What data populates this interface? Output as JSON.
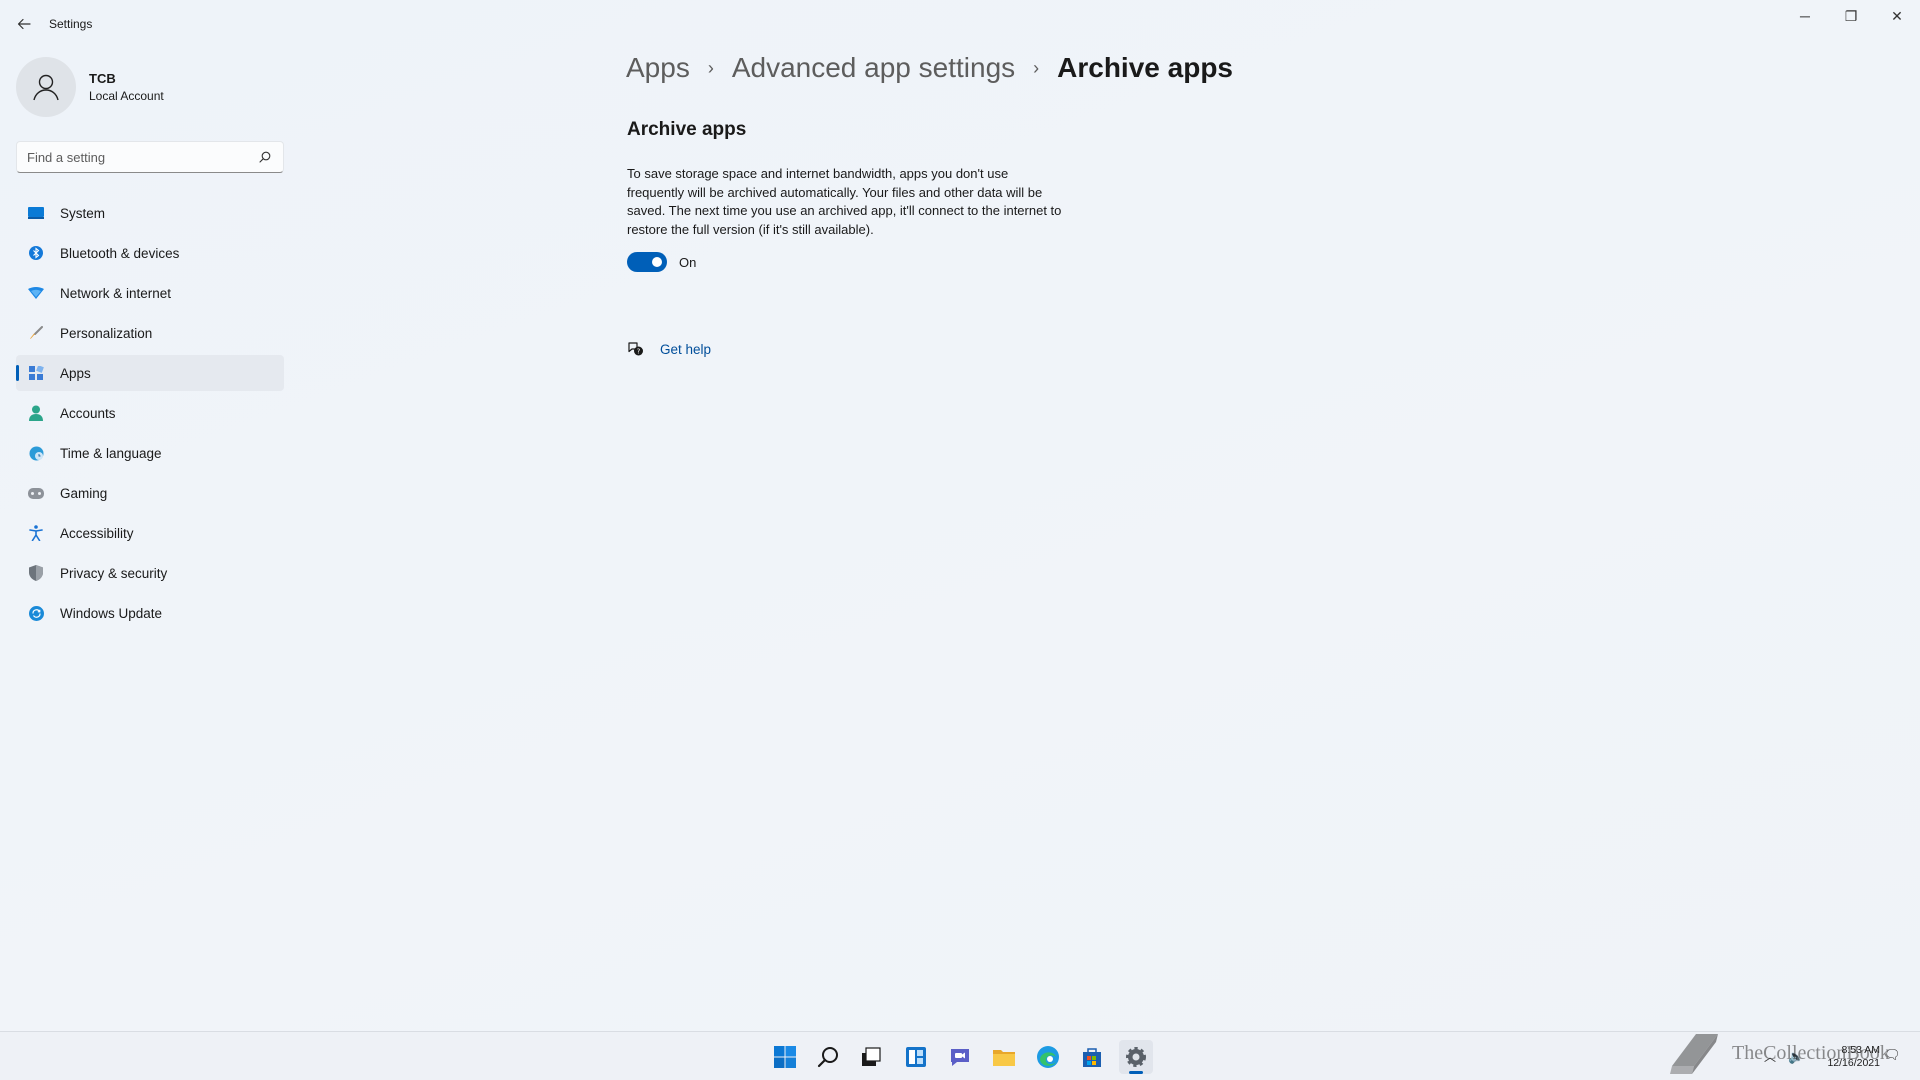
{
  "window": {
    "title": "Settings",
    "controls": {
      "minimize": "─",
      "maximize": "❐",
      "close": "✕"
    }
  },
  "profile": {
    "name": "TCB",
    "account_type": "Local Account"
  },
  "search": {
    "placeholder": "Find a setting"
  },
  "sidebar": {
    "items": [
      {
        "label": "System",
        "icon": "system-icon"
      },
      {
        "label": "Bluetooth & devices",
        "icon": "bluetooth-icon"
      },
      {
        "label": "Network & internet",
        "icon": "network-icon"
      },
      {
        "label": "Personalization",
        "icon": "brush-icon"
      },
      {
        "label": "Apps",
        "icon": "apps-icon",
        "selected": true
      },
      {
        "label": "Accounts",
        "icon": "accounts-icon"
      },
      {
        "label": "Time & language",
        "icon": "globe-clock-icon"
      },
      {
        "label": "Gaming",
        "icon": "gamepad-icon"
      },
      {
        "label": "Accessibility",
        "icon": "accessibility-icon"
      },
      {
        "label": "Privacy & security",
        "icon": "shield-icon"
      },
      {
        "label": "Windows Update",
        "icon": "update-icon"
      }
    ]
  },
  "breadcrumb": {
    "items": [
      "Apps",
      "Advanced app settings",
      "Archive apps"
    ],
    "separator": "›"
  },
  "main": {
    "section_title": "Archive apps",
    "description": "To save storage space and internet bandwidth, apps you don't use frequently will be archived automatically. Your files and other data will be saved. The next time you use an archived app, it'll connect to the internet to restore the full version (if it's still available).",
    "toggle": {
      "state": "On",
      "on": true
    },
    "help_link": "Get help"
  },
  "taskbar": {
    "icons": [
      "start-icon",
      "search-icon",
      "task-view-icon",
      "widgets-icon",
      "chat-icon",
      "file-explorer-icon",
      "edge-icon",
      "store-icon",
      "settings-icon"
    ],
    "active": "settings-icon",
    "clock_time": "8:53 AM",
    "clock_date": "12/16/2021"
  },
  "watermark": {
    "text": "TheCollectionBook"
  },
  "colors": {
    "accent": "#005fb8",
    "link": "#004e9a",
    "background": "#eef2f8"
  }
}
